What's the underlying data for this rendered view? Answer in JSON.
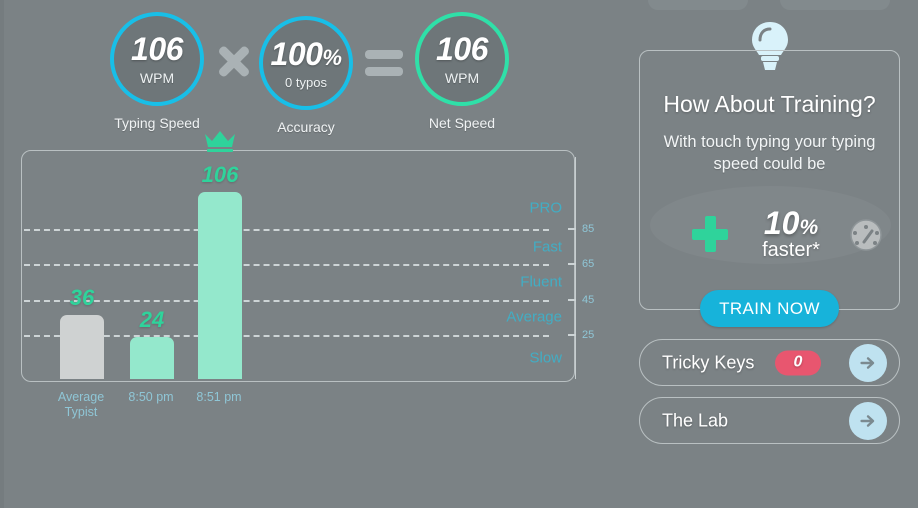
{
  "summary": {
    "metrics": [
      {
        "name": "typing-speed",
        "value": "106",
        "unit": "WPM",
        "caption": "Typing Speed",
        "ring_color": "#18bfe8"
      },
      {
        "name": "accuracy",
        "value": "100",
        "suffix": "%",
        "unit": "0  typos",
        "caption": "Accuracy",
        "ring_color": "#18bfe8"
      },
      {
        "name": "net-speed",
        "value": "106",
        "unit": "WPM",
        "caption": "Net Speed",
        "ring_color": "#2fe0a8"
      }
    ],
    "operators": [
      "times",
      "equals"
    ]
  },
  "chart_data": {
    "type": "bar",
    "title": "",
    "xlabel": "",
    "ylabel": "",
    "ylim": [
      0,
      120
    ],
    "grid": true,
    "categories": [
      "Average Typist",
      "8:50 pm",
      "8:51 pm"
    ],
    "category_lines": [
      [
        "Average",
        "Typist"
      ],
      [
        "8:50 pm"
      ],
      [
        "8:51 pm"
      ]
    ],
    "values": [
      36,
      24,
      106
    ],
    "value_labels": [
      "36",
      "24",
      "106"
    ],
    "bar_colors": [
      "#cfd2d2",
      "#94e8cc",
      "#94e8cc"
    ],
    "best_index": 2,
    "best_marker": "crown-icon",
    "gridlines": [
      {
        "value": 85,
        "label": "85"
      },
      {
        "value": 65,
        "label": "65"
      },
      {
        "value": 45,
        "label": "45"
      },
      {
        "value": 25,
        "label": "25"
      }
    ],
    "zones": [
      {
        "label": "PRO",
        "at": 97
      },
      {
        "label": "Fast",
        "at": 75
      },
      {
        "label": "Fluent",
        "at": 55
      },
      {
        "label": "Average",
        "at": 35
      },
      {
        "label": "Slow",
        "at": 12
      }
    ],
    "zone_color": "#39b5cf",
    "tick_color": "#8fc6d6"
  },
  "training": {
    "bulb_icon": "lightbulb-icon",
    "title": "How About Training?",
    "subtitle": "With touch typing your typing speed could be",
    "boost_value": "10",
    "boost_suffix": "%",
    "boost_label": "faster*",
    "plus_icon": "plus-icon",
    "gauge_icon": "speedometer-icon",
    "cta_label": "TRAIN NOW",
    "cta_color": "#17b3da"
  },
  "links": [
    {
      "name": "tricky-keys",
      "label": "Tricky Keys",
      "badge": "0",
      "badge_color": "#e8566f",
      "arrow": "arrow-right-icon"
    },
    {
      "name": "the-lab",
      "label": "The Lab",
      "badge": null,
      "arrow": "arrow-right-icon"
    }
  ]
}
